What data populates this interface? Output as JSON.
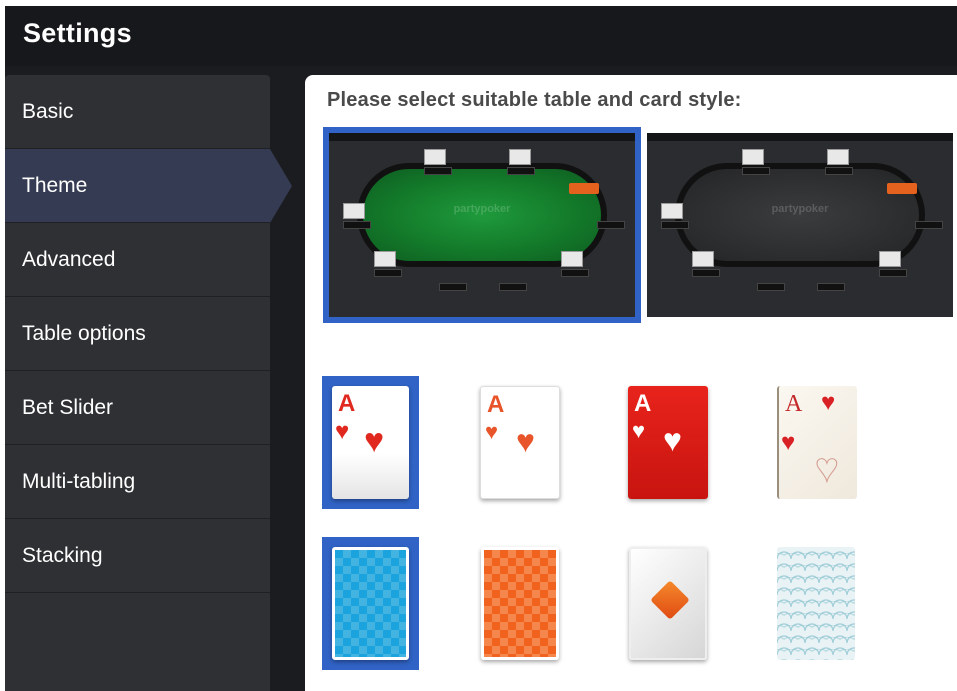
{
  "window": {
    "title": "Settings"
  },
  "sidebar": {
    "items": [
      {
        "label": "Basic",
        "active": false
      },
      {
        "label": "Theme",
        "active": true
      },
      {
        "label": "Advanced",
        "active": false
      },
      {
        "label": "Table options",
        "active": false
      },
      {
        "label": "Bet Slider",
        "active": false
      },
      {
        "label": "Multi-tabling",
        "active": false
      },
      {
        "label": "Stacking",
        "active": false
      }
    ]
  },
  "main": {
    "heading": "Please select suitable table and card style:",
    "tables": [
      {
        "id": "green-felt",
        "felt_color": "#138a30",
        "selected": true,
        "logo": "partypoker"
      },
      {
        "id": "dark-felt",
        "felt_color": "#2e3032",
        "selected": false,
        "logo": "partypoker"
      }
    ],
    "card_fronts": [
      {
        "style": "classic-white",
        "rank": "A",
        "suit": "♥",
        "selected": true
      },
      {
        "style": "simple-white",
        "rank": "A",
        "suit": "♥",
        "selected": false
      },
      {
        "style": "red",
        "rank": "A",
        "suit": "♥",
        "selected": false
      },
      {
        "style": "vintage",
        "rank": "A",
        "suit": "♥",
        "selected": false
      }
    ],
    "card_backs": [
      {
        "style": "blue-diamonds",
        "selected": true
      },
      {
        "style": "orange-diamonds",
        "selected": false
      },
      {
        "style": "white-diamond-logo",
        "selected": false
      },
      {
        "style": "teal-pattern",
        "selected": false
      }
    ]
  },
  "colors": {
    "accent": "#3063c5",
    "sidebar": "#2e3033",
    "active_item": "#353b52",
    "heart_red": "#e0281f"
  }
}
